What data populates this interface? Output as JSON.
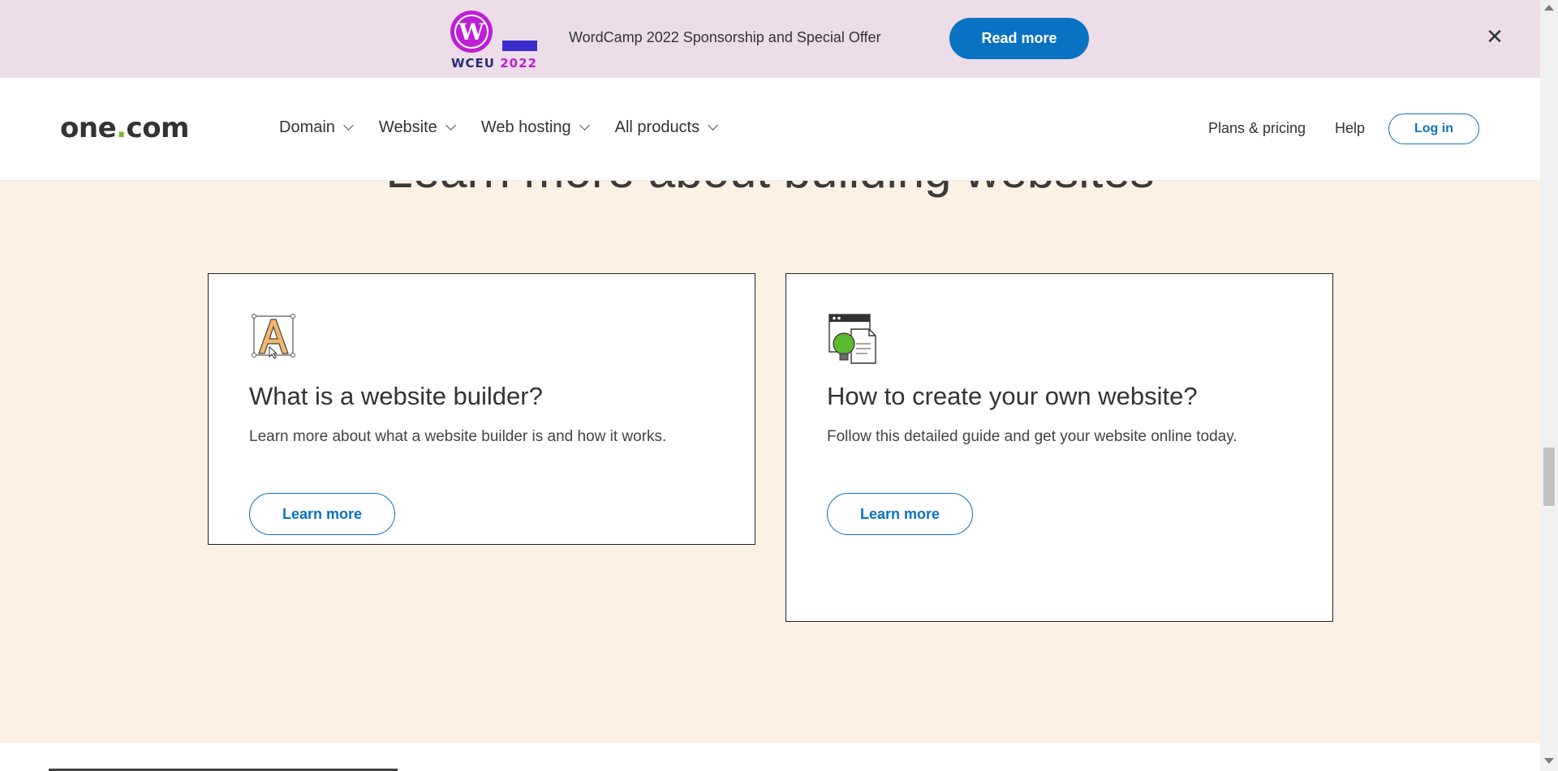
{
  "banner": {
    "logo_text_a": "WCEU",
    "logo_text_b": "2022",
    "wp_glyph": "W",
    "message": "WordCamp 2022 Sponsorship and Special Offer",
    "cta_label": "Read more",
    "close_glyph": "✕",
    "colors": {
      "background": "#ecdde9",
      "cta": "#0a72c3",
      "logo_purple": "#bd1fd6"
    }
  },
  "header": {
    "logo_a": "one",
    "logo_dot": ".",
    "logo_b": "com",
    "nav": [
      {
        "label": "Domain"
      },
      {
        "label": "Website"
      },
      {
        "label": "Web hosting"
      },
      {
        "label": "All products"
      }
    ],
    "plans_label": "Plans & pricing",
    "help_label": "Help",
    "login_label": "Log in"
  },
  "section": {
    "title": "Learn more about building websites"
  },
  "cards": [
    {
      "icon": "letter-a-editor-icon",
      "title": "What is a website builder?",
      "description": "Learn more about what a website builder is and how it works.",
      "button_label": "Learn more"
    },
    {
      "icon": "lightbulb-document-icon",
      "title": "How to create your own website?",
      "description": "Follow this detailed guide and get your website online today.",
      "button_label": "Learn more"
    }
  ],
  "colors": {
    "page_bg": "#fdf1e4",
    "accent": "#0a72c3",
    "logo_green": "#70b832"
  }
}
